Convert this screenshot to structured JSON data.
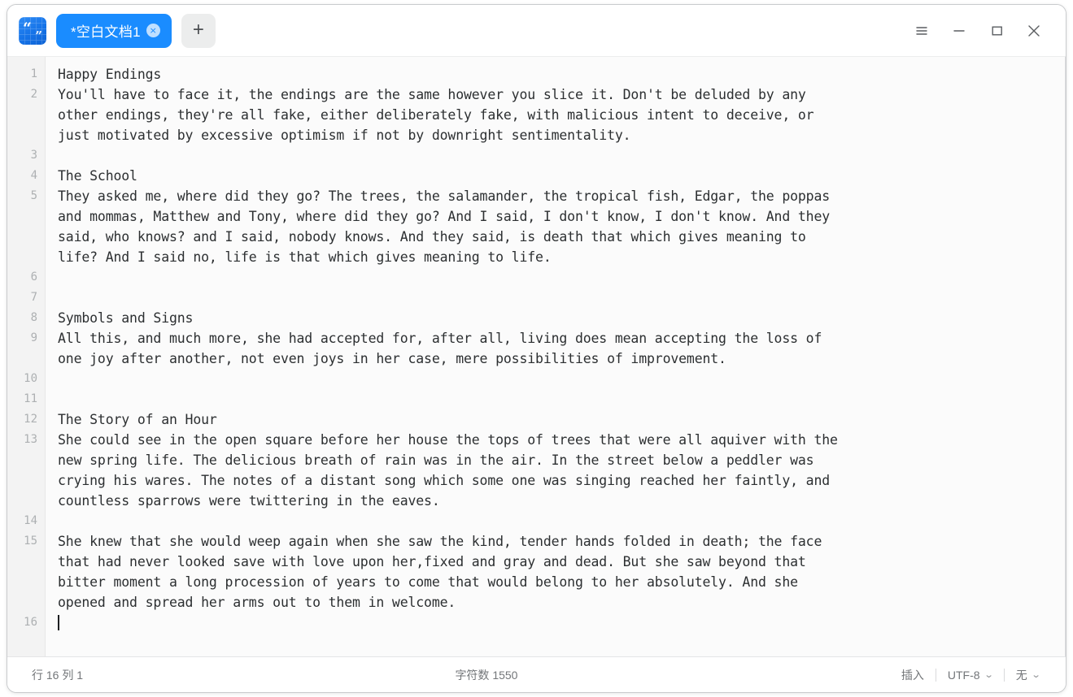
{
  "window": {
    "app_icon_name": "quote-book-icon",
    "app_icon_glyphs": [
      "“",
      "”"
    ]
  },
  "tabbar": {
    "tabs": [
      {
        "label": "*空白文档1",
        "close_glyph": "×",
        "active": true
      }
    ],
    "new_tab_label": "+"
  },
  "window_controls": {
    "menu_label": "menu",
    "minimize_label": "minimize",
    "maximize_label": "maximize",
    "close_label": "close"
  },
  "editor": {
    "line_numbers": [
      1,
      2,
      3,
      4,
      5,
      6,
      7,
      8,
      9,
      10,
      11,
      12,
      13,
      14,
      15,
      16
    ],
    "visual_lines": [
      "Happy Endings",
      "You'll have to face it, the endings are the same however you slice it. Don't be deluded by any",
      "other endings, they're all fake, either deliberately fake, with malicious intent to deceive, or",
      "just motivated by excessive optimism if not by downright sentimentality.",
      "",
      "The School",
      "They asked me, where did they go? The trees, the salamander, the tropical fish, Edgar, the poppas",
      "and mommas, Matthew and Tony, where did they go? And I said, I don't know, I don't know. And they",
      "said, who knows? and I said, nobody knows. And they said, is death that which gives meaning to",
      "life? And I said no, life is that which gives meaning to life.",
      "",
      "",
      "Symbols and Signs",
      "All this, and much more, she had accepted for, after all, living does mean accepting the loss of",
      "one joy after another, not even joys in her case, mere possibilities of improvement.",
      "",
      "",
      "The Story of an Hour",
      "She could see in the open square before her house the tops of trees that were all aquiver with the",
      "new spring life. The delicious breath of rain was in the air. In the street below a peddler was",
      "crying his wares. The notes of a distant song which some one was singing reached her faintly, and",
      "countless sparrows were twittering in the eaves.",
      "",
      "She knew that she would weep again when she saw the kind, tender hands folded in death; the face",
      "that had never looked save with love upon her,fixed and gray and dead. But she saw beyond that",
      "bitter moment a long procession of years to come that would belong to her absolutely. And she",
      "opened and spread her arms out to them in welcome.",
      ""
    ],
    "gutter_rows": [
      {
        "num": "1",
        "blank": false
      },
      {
        "num": "2",
        "blank": false
      },
      {
        "num": "",
        "blank": true
      },
      {
        "num": "",
        "blank": true
      },
      {
        "num": "3",
        "blank": false
      },
      {
        "num": "4",
        "blank": false
      },
      {
        "num": "5",
        "blank": false
      },
      {
        "num": "",
        "blank": true
      },
      {
        "num": "",
        "blank": true
      },
      {
        "num": "",
        "blank": true
      },
      {
        "num": "6",
        "blank": false
      },
      {
        "num": "7",
        "blank": false
      },
      {
        "num": "8",
        "blank": false
      },
      {
        "num": "9",
        "blank": false
      },
      {
        "num": "",
        "blank": true
      },
      {
        "num": "10",
        "blank": false
      },
      {
        "num": "11",
        "blank": false
      },
      {
        "num": "12",
        "blank": false
      },
      {
        "num": "13",
        "blank": false
      },
      {
        "num": "",
        "blank": true
      },
      {
        "num": "",
        "blank": true
      },
      {
        "num": "",
        "blank": true
      },
      {
        "num": "14",
        "blank": false
      },
      {
        "num": "15",
        "blank": false
      },
      {
        "num": "",
        "blank": true
      },
      {
        "num": "",
        "blank": true
      },
      {
        "num": "",
        "blank": true
      },
      {
        "num": "16",
        "blank": false
      }
    ]
  },
  "statusbar": {
    "cursor_position": "行 16  列 1",
    "char_count": "字符数 1550",
    "insert_mode": "插入",
    "encoding": "UTF-8",
    "line_ending": "无",
    "chevron_glyph": "⌄"
  },
  "colors": {
    "accent": "#1a8cff",
    "window_bg": "#ffffff",
    "editor_bg": "#fbfbfb",
    "gutter_bg": "#f3f3f3",
    "text": "#2c2f31",
    "muted": "#adb0b2"
  }
}
